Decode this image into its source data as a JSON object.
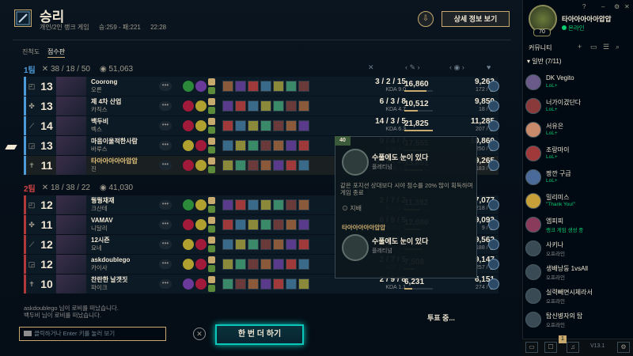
{
  "header": {
    "title": "승리",
    "game_type": "개인/2인 랭크 게임",
    "lp": "승:259 - 패:221",
    "duration": "22:28",
    "detail_button": "상세 정보 보기",
    "download_icon": "download-icon"
  },
  "tabs": {
    "growth": "진척도",
    "scoreboard": "점수판"
  },
  "teams": [
    {
      "name": "1팀",
      "kda": "38 / 18 / 50",
      "gold": "51,063",
      "color": "#4c9bd8",
      "players": [
        {
          "pos": "top",
          "level": "13",
          "name": "Coorong",
          "champ": "오른",
          "kda": "3 / 2 / 15",
          "kda_ratio": "KDA 9.0",
          "damage": "16,860",
          "damage_pct": 0.77,
          "gold": "9,263",
          "cs": "172 / 분",
          "spell1": "#2a8a3a",
          "spell2": "#6a3a9a",
          "me": false
        },
        {
          "pos": "jungle",
          "level": "13",
          "name": "제 4차 산업",
          "champ": "카직스",
          "kda": "6 / 3 / 8",
          "kda_ratio": "KDA 4.7",
          "damage": "10,512",
          "damage_pct": 0.48,
          "gold": "9,850",
          "cs": "18 / 분",
          "spell1": "#a21a3a",
          "spell2": "#b0a030",
          "me": false
        },
        {
          "pos": "mid",
          "level": "14",
          "name": "백두비",
          "champ": "벡스",
          "kda": "14 / 3 / 5",
          "kda_ratio": "KDA 6.3",
          "damage": "21,825",
          "damage_pct": 1.0,
          "gold": "11,285",
          "cs": "207 / 분",
          "spell1": "#a21a3a",
          "spell2": "#b0a030",
          "me": false
        },
        {
          "pos": "bottom",
          "level": "13",
          "name": "마음이울적한사람",
          "champ": "바루스",
          "kda": "9 / 4 / 7",
          "kda_ratio": "KDA 4.0",
          "damage": "17,555",
          "damage_pct": 0.8,
          "gold": "10,860",
          "cs": "250 / 분",
          "spell1": "#b0a030",
          "spell2": "#a21a3a",
          "me": false
        },
        {
          "pos": "support",
          "level": "11",
          "name": "타아아아아아압압",
          "champ": "진",
          "kda": "6 / 6 / 15",
          "kda_ratio": "KDA 3.5",
          "damage": "13,851",
          "damage_pct": 0.63,
          "gold": "9,265",
          "cs": "183 / 분",
          "spell1": "#a21a3a",
          "spell2": "#b0a030",
          "me": true
        }
      ]
    },
    {
      "name": "2팀",
      "kda": "18 / 38 / 22",
      "gold": "41,030",
      "color": "#b03a3a",
      "players": [
        {
          "pos": "top",
          "level": "12",
          "name": "뭥뭥재재",
          "champ": "크산테",
          "kda": "2 / 7 / 2",
          "kda_ratio": "KDA 0.6",
          "damage": "11,392",
          "damage_pct": 0.52,
          "gold": "7,077",
          "cs": "218 / 분",
          "spell1": "#2a8a3a",
          "spell2": "#b0a030",
          "me": false
        },
        {
          "pos": "jungle",
          "level": "11",
          "name": "VAMAV",
          "champ": "니달리",
          "kda": "6 / 9 / 5",
          "kda_ratio": "KDA 1.2",
          "damage": "12,080",
          "damage_pct": 0.55,
          "gold": "9,093",
          "cs": "9 / 분",
          "spell1": "#a21a3a",
          "spell2": "#b0a030",
          "me": false
        },
        {
          "pos": "mid",
          "level": "12",
          "name": "12시즌",
          "champ": "요네",
          "kda": "6 / 8 / 6",
          "kda_ratio": "KDA 1.5",
          "damage": "13,413",
          "damage_pct": 0.61,
          "gold": "9,562",
          "cs": "188 / 분",
          "spell1": "#b0a030",
          "spell2": "#a21a3a",
          "me": false
        },
        {
          "pos": "bottom",
          "level": "12",
          "name": "askdoublego",
          "champ": "카이사",
          "kda": "2 / 7 / 5",
          "kda_ratio": "KDA 1.0",
          "damage": "7,508",
          "damage_pct": 0.34,
          "gold": "9,147",
          "cs": "257 / 분",
          "spell1": "#b0a030",
          "spell2": "#a21a3a",
          "me": false
        },
        {
          "pos": "support",
          "level": "10",
          "name": "찬란한 날갯짓",
          "champ": "파이크",
          "kda": "2 / 9 / 8",
          "kda_ratio": "KDA 1.1",
          "damage": "6,231",
          "damage_pct": 0.29,
          "gold": "6,151",
          "cs": "274 / 분",
          "spell1": "#6a3a9a",
          "spell2": "#a21a3a",
          "me": false
        }
      ]
    }
  ],
  "tooltip": {
    "badge": "40",
    "title1": "수풀에도 눈이 있다",
    "sub1": "플레티넘",
    "desc": "같은 포지션 상대보다 시야 점수를 20% 많이 획득하며 게임 종료",
    "lock": "지배",
    "name2": "타아아아아아압압",
    "title2": "수풀에도 눈이 있다",
    "sub2": "플레티넘"
  },
  "chat": {
    "line1": "askdoublego 님이 로비를 떠났습니다.",
    "line2": "백두비 님이 로비를 떠났습니다.",
    "placeholder": "클릭하거나 Enter 키를 눌러 보기"
  },
  "play_again": "한 번 더 하기",
  "vote": "투표 중...",
  "social": {
    "my_name": "타아아아아아압압",
    "my_status": "온라인",
    "level": "70",
    "title": "커뮤니티",
    "group": "일반 (7/11)",
    "friends": [
      {
        "name": "DK Vegito",
        "status": "LoL+",
        "online": true,
        "color": "#6a5a8a"
      },
      {
        "name": "너가이겼단다",
        "status": "LoL+",
        "online": true,
        "color": "#8a3a3a"
      },
      {
        "name": "서유은",
        "status": "LoL+",
        "online": true,
        "color": "#c88a6a"
      },
      {
        "name": "조랑마이",
        "status": "LoL+",
        "online": true,
        "color": "#a03a3a"
      },
      {
        "name": "짱깐 구급",
        "status": "LoL+",
        "online": true,
        "color": "#4a6a9a"
      },
      {
        "name": "밀리미스",
        "status": "\"Thank You!\"",
        "online": true,
        "color": "#c8a03a"
      },
      {
        "name": "엠피피",
        "status": "랭크 게임 생성 중",
        "online": true,
        "color": "#8a3a5a"
      },
      {
        "name": "사키나",
        "status": "오프라인",
        "online": false,
        "color": "#3a4a55"
      },
      {
        "name": "생배낭둥 1vsAll",
        "status": "오프라인",
        "online": false,
        "color": "#3a4a55"
      },
      {
        "name": "실력빼면시체라서",
        "status": "오프라인",
        "online": false,
        "color": "#3a4a55"
      },
      {
        "name": "탑신병자의 탑",
        "status": "오프라인",
        "online": false,
        "color": "#3a4a55"
      }
    ],
    "version": "V13.1",
    "notif": "1"
  },
  "colors": {
    "accent": "#c8aa6e",
    "blue_team": "#4c9bd8",
    "red_team": "#b03a3a",
    "teal": "#0ac8b9"
  }
}
